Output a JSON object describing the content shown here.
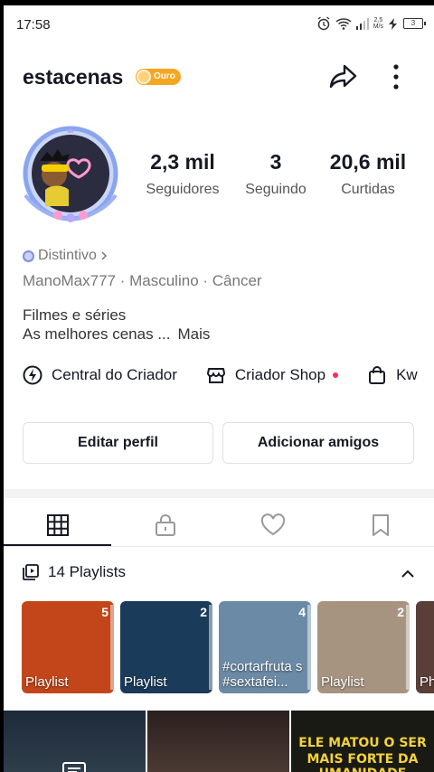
{
  "status_bar": {
    "time": "17:58",
    "net_speed_value": "2,5",
    "net_speed_unit": "M/s",
    "battery": "3"
  },
  "profile": {
    "username": "estacenas",
    "badge_label": "Ouro",
    "stats": [
      {
        "value": "2,3 mil",
        "label": "Seguidores"
      },
      {
        "value": "3",
        "label": "Seguindo"
      },
      {
        "value": "20,6 mil",
        "label": "Curtidas"
      }
    ],
    "distintivo": "Distintivo",
    "meta": "ManoMax777 · Masculino · Câncer",
    "bio_line1": "Filmes e séries",
    "bio_line2": "As melhores cenas ...",
    "bio_more": "Mais"
  },
  "links": {
    "creator_center": "Central do Criador",
    "creator_shop": "Criador Shop",
    "kw": "Kw"
  },
  "buttons": {
    "edit_profile": "Editar perfil",
    "add_friends": "Adicionar amigos"
  },
  "tabs": [
    "videos-grid",
    "private-lock",
    "liked-heart",
    "favorites-bookmark"
  ],
  "playlists": {
    "header": "14 Playlists",
    "items": [
      {
        "title": "Playlist",
        "count": "5",
        "bg": "#c2461a"
      },
      {
        "title": "Playlist",
        "count": "2",
        "bg": "#1b3b5a"
      },
      {
        "title": "#cortarfruta s #sextafei...",
        "count": "4",
        "bg": "#6b8aa5"
      },
      {
        "title": "Playlist",
        "count": "2",
        "bg": "#a79480"
      },
      {
        "title": "Ph",
        "count": "",
        "bg": "#5a3e38"
      }
    ]
  },
  "grid": {
    "video3_line1": "ELE MATOU O SER",
    "video3_line2": "MAIS FORTE DA UMANIDADE"
  },
  "colors": {
    "accent_red": "#fe2c55",
    "badge_gold": "#f5a623",
    "text_primary": "#161823"
  }
}
